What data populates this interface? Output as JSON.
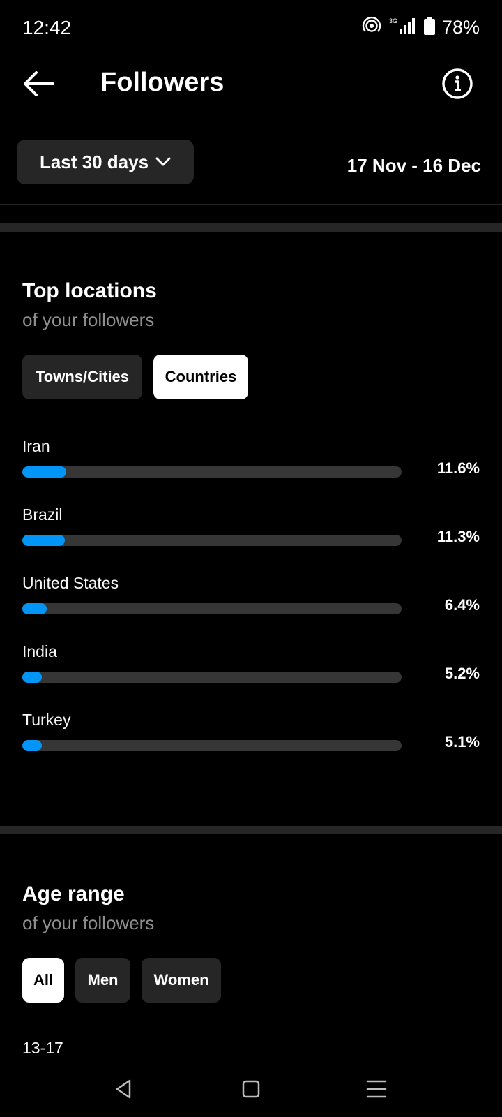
{
  "status_bar": {
    "time": "12:42",
    "network": "3G",
    "battery": "78%"
  },
  "header": {
    "title": "Followers"
  },
  "filter": {
    "date_label": "Last 30 days",
    "date_range": "17 Nov - 16 Dec"
  },
  "top_locations": {
    "title": "Top locations",
    "subtitle": "of your followers",
    "tabs": [
      {
        "label": "Towns/Cities",
        "selected": false
      },
      {
        "label": "Countries",
        "selected": true
      }
    ],
    "items": [
      {
        "name": "Iran",
        "percent_label": "11.6%",
        "value": 11.6
      },
      {
        "name": "Brazil",
        "percent_label": "11.3%",
        "value": 11.3
      },
      {
        "name": "United States",
        "percent_label": "6.4%",
        "value": 6.4
      },
      {
        "name": "India",
        "percent_label": "5.2%",
        "value": 5.2
      },
      {
        "name": "Turkey",
        "percent_label": "5.1%",
        "value": 5.1
      }
    ]
  },
  "age_range": {
    "title": "Age range",
    "subtitle": "of your followers",
    "tabs": [
      {
        "label": "All",
        "selected": true
      },
      {
        "label": "Men",
        "selected": false
      },
      {
        "label": "Women",
        "selected": false
      }
    ],
    "first_bucket": "13-17"
  },
  "colors": {
    "accent": "#0095f6",
    "track": "#363636",
    "chip": "#262626"
  }
}
